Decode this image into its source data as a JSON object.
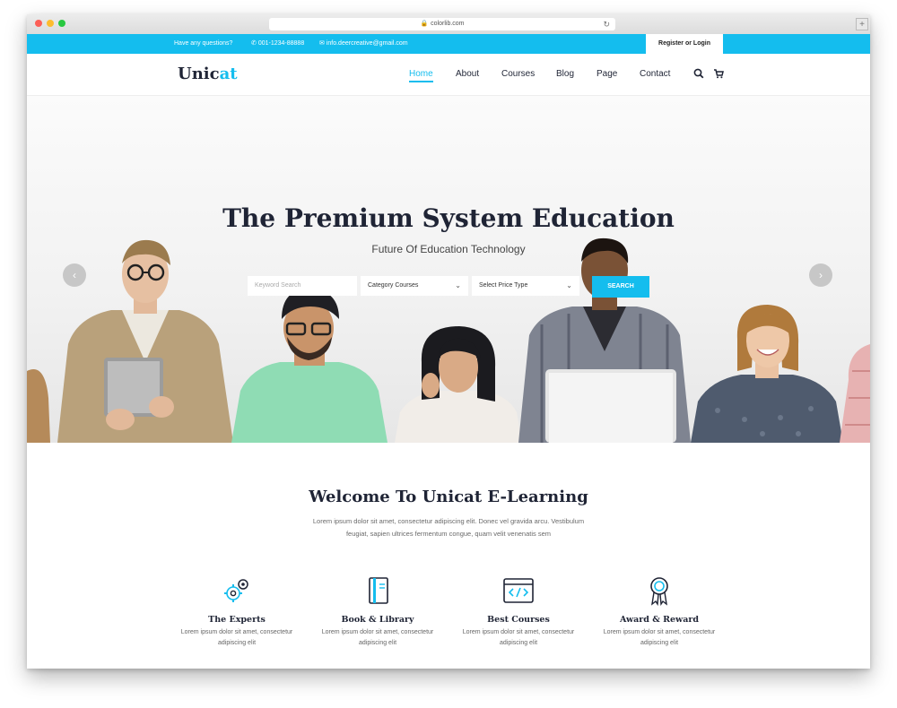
{
  "browser": {
    "url": "colorlib.com"
  },
  "topbar": {
    "question": "Have any questions?",
    "phone": "001-1234-88888",
    "email": "info.deercreative@gmail.com",
    "register_login": "Register or Login"
  },
  "header": {
    "logo_main": "Unic",
    "logo_accent": "at",
    "nav": [
      {
        "label": "Home",
        "active": true
      },
      {
        "label": "About"
      },
      {
        "label": "Courses"
      },
      {
        "label": "Blog"
      },
      {
        "label": "Page"
      },
      {
        "label": "Contact"
      }
    ],
    "icons": [
      "search-icon",
      "cart-icon"
    ]
  },
  "hero": {
    "title": "The Premium System Education",
    "subtitle": "Future Of Education Technology",
    "search": {
      "keyword_placeholder": "Keyword Search",
      "category_value": "Category Courses",
      "price_value": "Select Price Type",
      "button": "SEARCH"
    },
    "prev_icon": "chevron-left-icon",
    "next_icon": "chevron-right-icon"
  },
  "welcome": {
    "title": "Welcome To Unicat E-Learning",
    "text": "Lorem ipsum dolor sit amet, consectetur adipiscing elit. Donec vel gravida arcu. Vestibulum feugiat, sapien ultrices fermentum congue, quam velit venenatis sem"
  },
  "features": [
    {
      "icon": "gears-icon",
      "title": "The Experts",
      "text": "Lorem ipsum dolor sit amet, consectetur adipiscing elit"
    },
    {
      "icon": "book-icon",
      "title": "Book & Library",
      "text": "Lorem ipsum dolor sit amet, consectetur adipiscing elit"
    },
    {
      "icon": "code-window-icon",
      "title": "Best Courses",
      "text": "Lorem ipsum dolor sit amet, consectetur adipiscing elit"
    },
    {
      "icon": "award-ribbon-icon",
      "title": "Award & Reward",
      "text": "Lorem ipsum dolor sit amet, consectetur adipiscing elit"
    }
  ],
  "colors": {
    "accent": "#14bdee",
    "dark": "#1f2435"
  }
}
